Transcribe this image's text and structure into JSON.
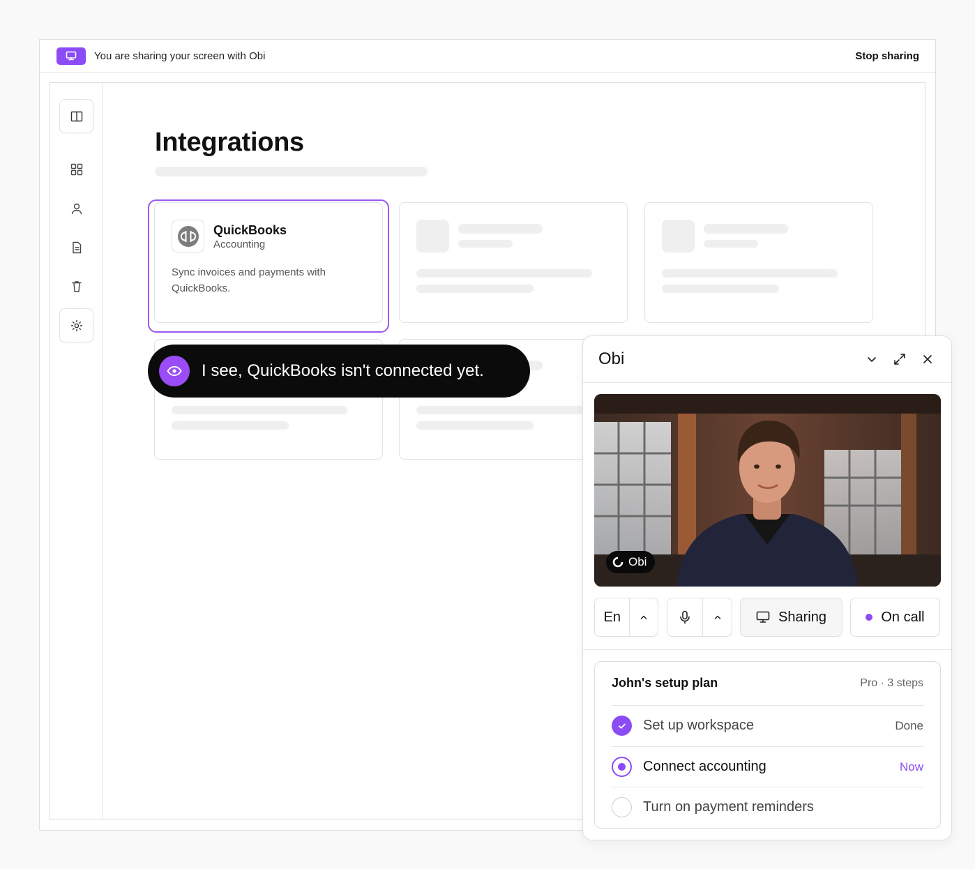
{
  "share_bar": {
    "message": "You are sharing your screen with Obi",
    "stop_label": "Stop sharing",
    "icon": "monitor-icon"
  },
  "sidebar": {
    "items": [
      {
        "icon": "book-open-icon"
      },
      {
        "icon": "grid-icon"
      },
      {
        "icon": "user-icon"
      },
      {
        "icon": "document-icon"
      },
      {
        "icon": "trash-icon"
      },
      {
        "icon": "gear-icon"
      }
    ]
  },
  "page": {
    "title": "Integrations"
  },
  "cards": [
    {
      "title": "QuickBooks",
      "subtitle": "Accounting",
      "description": "Sync invoices and payments with QuickBooks.",
      "logo": "quickbooks-logo"
    }
  ],
  "toast": {
    "icon": "eye-icon",
    "message": "I see, QuickBooks isn't connected yet."
  },
  "obi": {
    "title": "Obi",
    "video_badge": "Obi",
    "controls": {
      "language": "En",
      "sharing_label": "Sharing",
      "call_label": "On call"
    },
    "plan": {
      "title": "John's setup plan",
      "meta": "Pro · 3 steps",
      "steps": [
        {
          "label": "Set up workspace",
          "status": "Done",
          "state": "done"
        },
        {
          "label": "Connect accounting",
          "status": "Now",
          "state": "current"
        },
        {
          "label": "Turn on payment reminders",
          "status": "",
          "state": "pending"
        }
      ]
    }
  },
  "colors": {
    "accent": "#8b4cf6",
    "toast_bg": "#0b0b0b",
    "skeleton": "#efefef"
  }
}
